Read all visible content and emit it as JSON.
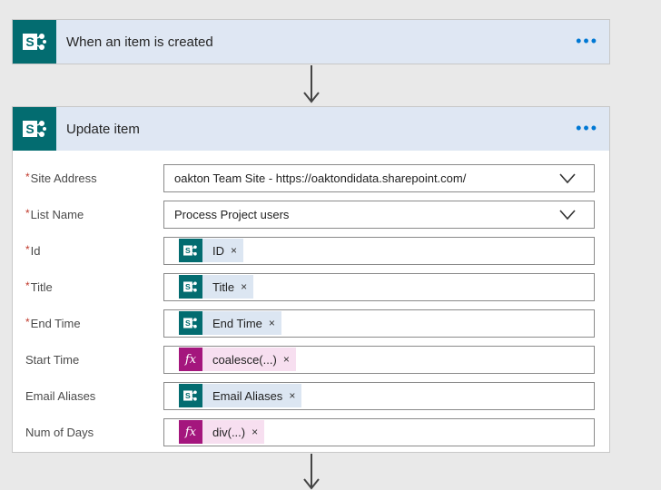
{
  "trigger": {
    "title": "When an item is created",
    "icon": "sharepoint-icon",
    "menu_label": "•••"
  },
  "action": {
    "title": "Update item",
    "icon": "sharepoint-icon",
    "menu_label": "•••",
    "required_mark": "*",
    "fields": [
      {
        "label": "Site Address",
        "required": true,
        "type": "dropdown",
        "value": "oakton Team Site - https://oaktondidata.sharepoint.com/"
      },
      {
        "label": "List Name",
        "required": true,
        "type": "dropdown",
        "value": "Process Project users"
      },
      {
        "label": "Id",
        "required": true,
        "type": "token",
        "token_kind": "sharepoint",
        "value": "ID"
      },
      {
        "label": "Title",
        "required": true,
        "type": "token",
        "token_kind": "sharepoint",
        "value": "Title"
      },
      {
        "label": "End Time",
        "required": true,
        "type": "token",
        "token_kind": "sharepoint",
        "value": "End Time"
      },
      {
        "label": "Start Time",
        "required": false,
        "type": "token",
        "token_kind": "expression",
        "value": "coalesce(...)"
      },
      {
        "label": "Email Aliases",
        "required": false,
        "type": "token",
        "token_kind": "sharepoint",
        "value": "Email Aliases"
      },
      {
        "label": "Num of Days",
        "required": false,
        "type": "token",
        "token_kind": "expression",
        "value": "div(...)"
      }
    ]
  },
  "token_remove_glyph": "×",
  "expression_glyph": "fx",
  "colors": {
    "sharepoint": "#036c70",
    "expression": "#a4167d",
    "header_bg": "#dfe7f3",
    "accent": "#0078d4"
  }
}
